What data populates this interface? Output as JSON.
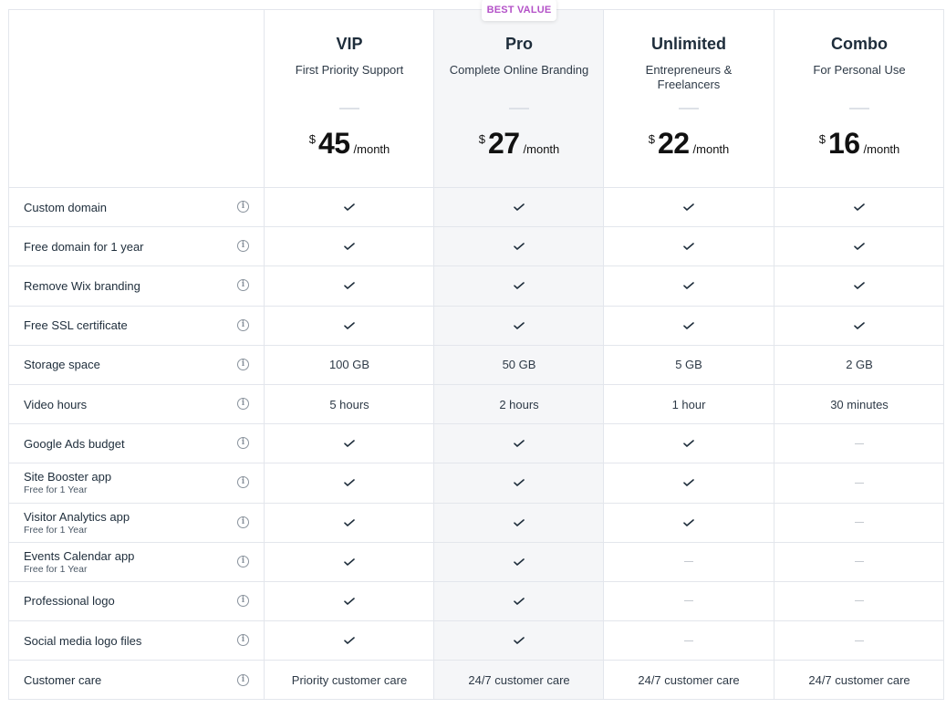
{
  "badge": "BEST VALUE",
  "plans": [
    {
      "name": "VIP",
      "desc": "First Priority Support",
      "currency": "$",
      "price": "45",
      "period": "/month"
    },
    {
      "name": "Pro",
      "desc": "Complete Online Branding",
      "currency": "$",
      "price": "27",
      "period": "/month",
      "highlighted": true
    },
    {
      "name": "Unlimited",
      "desc": "Entrepreneurs & Freelancers",
      "currency": "$",
      "price": "22",
      "period": "/month"
    },
    {
      "name": "Combo",
      "desc": "For Personal Use",
      "currency": "$",
      "price": "16",
      "period": "/month"
    }
  ],
  "features": [
    {
      "label": "Custom domain",
      "sub": "",
      "values": [
        "check",
        "check",
        "check",
        "check"
      ]
    },
    {
      "label": "Free domain for 1 year",
      "sub": "",
      "values": [
        "check",
        "check",
        "check",
        "check"
      ]
    },
    {
      "label": "Remove Wix branding",
      "sub": "",
      "values": [
        "check",
        "check",
        "check",
        "check"
      ]
    },
    {
      "label": "Free SSL certificate",
      "sub": "",
      "values": [
        "check",
        "check",
        "check",
        "check"
      ]
    },
    {
      "label": "Storage space",
      "sub": "",
      "values": [
        "100 GB",
        "50 GB",
        "5 GB",
        "2 GB"
      ]
    },
    {
      "label": "Video hours",
      "sub": "",
      "values": [
        "5 hours",
        "2 hours",
        "1 hour",
        "30 minutes"
      ]
    },
    {
      "label": "Google Ads budget",
      "sub": "",
      "values": [
        "check",
        "check",
        "check",
        "dash"
      ]
    },
    {
      "label": "Site Booster app",
      "sub": "Free for 1 Year",
      "values": [
        "check",
        "check",
        "check",
        "dash"
      ]
    },
    {
      "label": "Visitor Analytics app",
      "sub": "Free for 1 Year",
      "values": [
        "check",
        "check",
        "check",
        "dash"
      ]
    },
    {
      "label": "Events Calendar app",
      "sub": "Free for 1 Year",
      "values": [
        "check",
        "check",
        "dash",
        "dash"
      ]
    },
    {
      "label": "Professional logo",
      "sub": "",
      "values": [
        "check",
        "check",
        "dash",
        "dash"
      ]
    },
    {
      "label": "Social media logo files",
      "sub": "",
      "values": [
        "check",
        "check",
        "dash",
        "dash"
      ]
    },
    {
      "label": "Customer care",
      "sub": "",
      "values": [
        "Priority customer care",
        "24/7 customer care",
        "24/7 customer care",
        "24/7 customer care"
      ]
    }
  ],
  "icons": {
    "info": "info-circle-icon",
    "check": "checkmark-icon",
    "dash": "dash-icon"
  },
  "colors": {
    "badge_text": "#b452c8",
    "highlight_bg": "#f5f6f8",
    "border": "#e3e6ec",
    "text": "#1e2d3b"
  }
}
